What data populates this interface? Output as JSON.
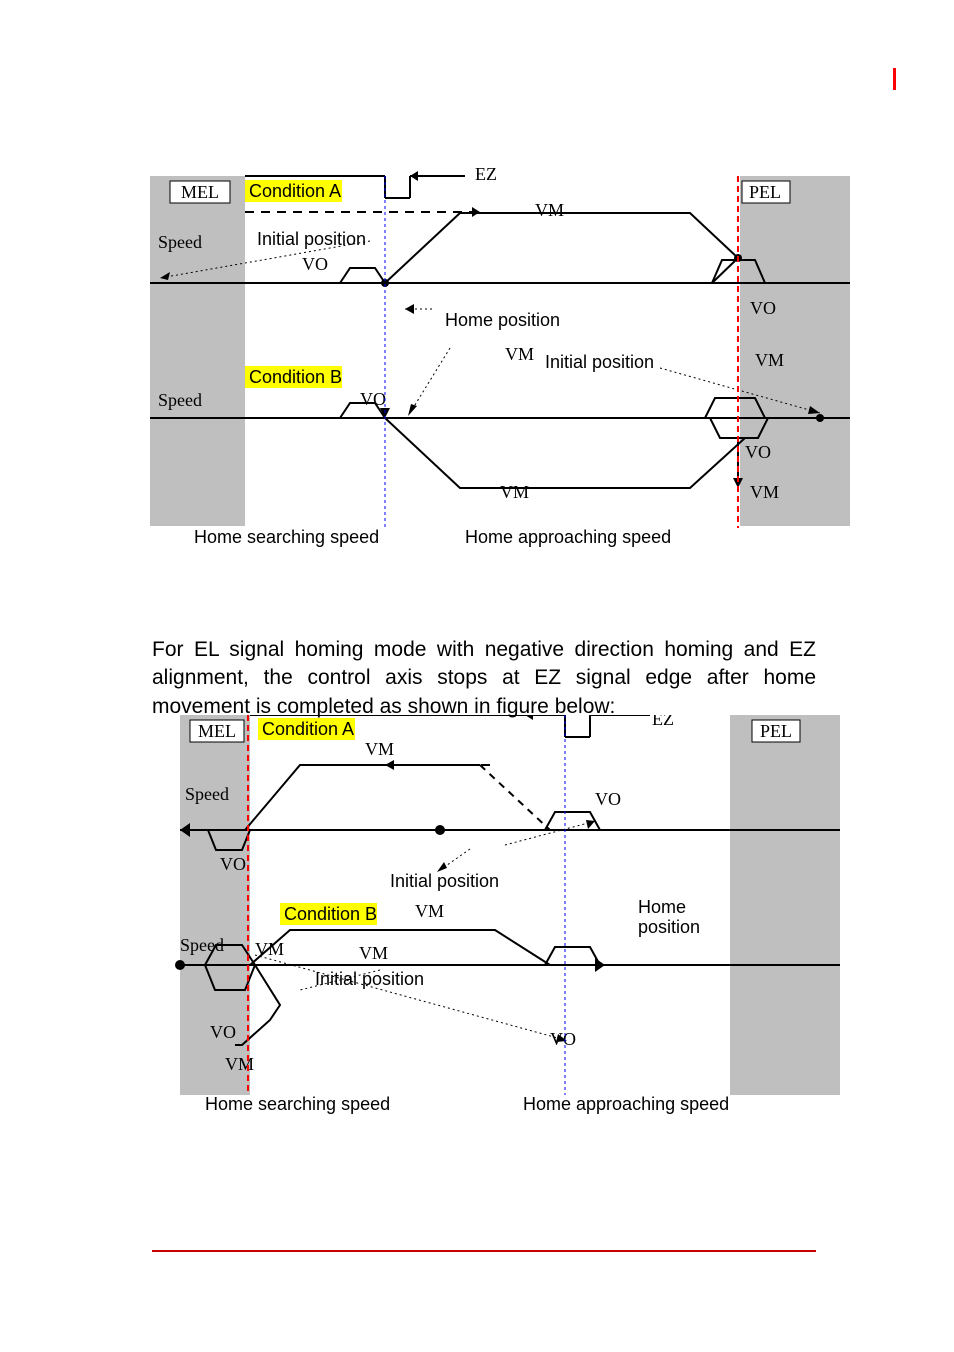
{
  "paragraph": "For EL signal homing mode with negative direction homing and EZ alignment,  the control axis stops at EZ signal edge after home movement is completed as shown in figure below:",
  "diagram1": {
    "condA": "Condition A",
    "condB": "Condition B",
    "mel": "MEL",
    "pel": "PEL",
    "speed": "Speed",
    "ez": "EZ",
    "vm": "VM",
    "vo": "VO",
    "initial": "Initial position",
    "home_position": "Home position",
    "search_label": "Home searching speed",
    "approach_label": "Home approaching speed"
  },
  "diagram2": {
    "condA": "Condition A",
    "condB": "Condition B",
    "mel": "MEL",
    "pel": "PEL",
    "speed": "Speed",
    "ez": "EZ",
    "vm": "VM",
    "vo": "VO",
    "initial": "Initial position",
    "home_position": "Home\nposition",
    "search_label": "Home searching speed",
    "approach_label": "Home approaching speed"
  }
}
